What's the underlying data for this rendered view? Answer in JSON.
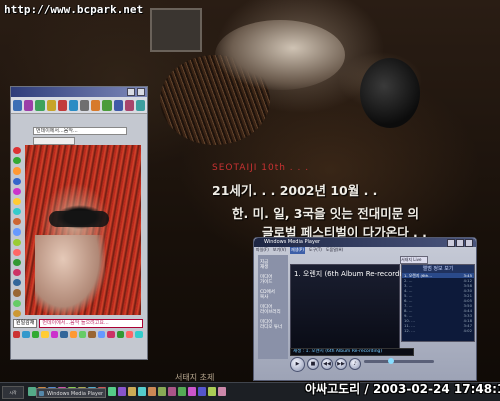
{
  "desktop": {
    "url_text": "http://www.bcpark.net",
    "wallpaper_lines": [
      "SEOTAIJI 10th . . .",
      "21세기. . . 2002년 10월 . .",
      "한. 미. 일, 3국을 잇는 전대미문 의",
      "글로벌 페스티벌이 다가온다 . ."
    ],
    "caption_bottom": "서태지 초제",
    "watermark": "아싸고도리 / 2003-02-24 17:48:19"
  },
  "chat_window": {
    "input_value": "번데이에서...음악...",
    "status_label": "원일감재",
    "status_value": "번데이에서...음악 들으려고요...",
    "toolbar_colors": [
      "#3d6fb5",
      "#9c3fa8",
      "#3ea25a",
      "#c7a42a",
      "#c23b3b",
      "#2b8cc4",
      "#6f6f6f",
      "#d77a2c",
      "#4c9c3a",
      "#3f5aa8",
      "#a8456b",
      "#3c9f9f"
    ],
    "side_colors": [
      "#d33",
      "#3a3",
      "#f93",
      "#36c",
      "#c3c",
      "#fc3",
      "#3cc",
      "#c63",
      "#69f",
      "#9c3",
      "#f66",
      "#393",
      "#c36",
      "#369",
      "#963",
      "#6c6",
      "#c93"
    ],
    "bottom_colors": [
      "#c33",
      "#39c",
      "#3a3",
      "#fc3",
      "#c3c",
      "#369",
      "#f93",
      "#6c6",
      "#963",
      "#69f",
      "#c36",
      "#393",
      "#f66",
      "#3cc"
    ]
  },
  "media_player": {
    "title": "Windows Media Player",
    "menu": [
      "파일(F)",
      "보기(V)",
      "재생(P)",
      "도구(T)",
      "도움말(H)"
    ],
    "menu_active": 2,
    "taskbar_items": [
      "지금\n재생",
      "미디어\n가이드",
      "CD에서\n복사",
      "미디어\n라이브러리",
      "미디어\n라디오 튜너"
    ],
    "track": "1. 오렌지 (6th Album Re-recording)",
    "dropdown": "서태지 Live",
    "list_header": "앨범 정보 보기",
    "playlist": [
      {
        "title": "1. 오렌지 (6th...",
        "time": "3:45",
        "selected": true
      },
      {
        "title": "2. ...",
        "time": "4:12"
      },
      {
        "title": "3. ...",
        "time": "3:58"
      },
      {
        "title": "4. ...",
        "time": "4:30"
      },
      {
        "title": "5. ...",
        "time": "3:21"
      },
      {
        "title": "6. ...",
        "time": "4:05"
      },
      {
        "title": "7. ...",
        "time": "3:50"
      },
      {
        "title": "8. ...",
        "time": "4:44"
      },
      {
        "title": "9. ...",
        "time": "3:33"
      },
      {
        "title": "10. ...",
        "time": "4:18"
      },
      {
        "title": "11. ...",
        "time": "3:47"
      },
      {
        "title": "12. ...",
        "time": "4:02"
      }
    ],
    "status_line": "재생 : 1. 오렌지 (6th Album Re-recording)",
    "controls": [
      "▶",
      "■",
      "◀◀",
      "▶▶",
      "♪"
    ]
  },
  "taskbar": {
    "start_label": "시작",
    "active_task": "Windows Media Player",
    "tray_colors": [
      "#5a8",
      "#c84",
      "#58c",
      "#c5a",
      "#8c5",
      "#aa5",
      "#5ac",
      "#c55",
      "#5c8",
      "#85c",
      "#ca5",
      "#5cc",
      "#c85",
      "#8a5",
      "#a58",
      "#5a5",
      "#c5c",
      "#55c",
      "#ac5",
      "#c8a"
    ]
  }
}
